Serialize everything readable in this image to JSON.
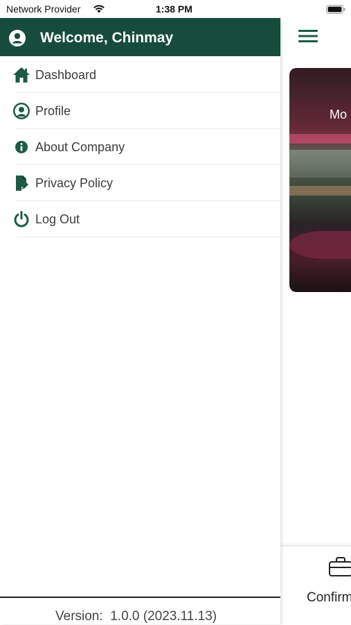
{
  "status_bar": {
    "carrier": "Network Provider",
    "time": "1:38 PM"
  },
  "drawer": {
    "welcome_text": "Welcome, Chinmay",
    "items": [
      {
        "label": "Dashboard",
        "icon": "home-icon"
      },
      {
        "label": "Profile",
        "icon": "profile-icon"
      },
      {
        "label": "About Company",
        "icon": "info-icon"
      },
      {
        "label": "Privacy Policy",
        "icon": "document-icon"
      },
      {
        "label": "Log Out",
        "icon": "power-icon"
      }
    ],
    "version_prefix": "Version:",
    "version_value": "1.0.0 (2023.11.13)"
  },
  "background": {
    "hero_text": "Mo",
    "tab_label": "Confirm"
  },
  "colors": {
    "header_green": "#174c3c",
    "accent_green": "#1d5a45"
  }
}
